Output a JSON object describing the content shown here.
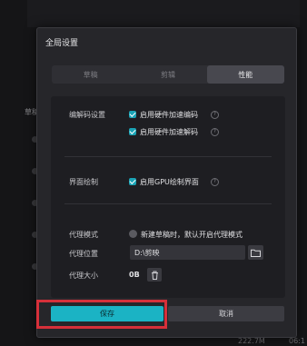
{
  "dialog": {
    "title": "全局设置",
    "tabs": [
      {
        "label": "草稿",
        "active": false
      },
      {
        "label": "剪辑",
        "active": false
      },
      {
        "label": "性能",
        "active": true
      }
    ]
  },
  "codec": {
    "label": "编解码设置",
    "options": [
      {
        "label": "启用硬件加速编码",
        "checked": true
      },
      {
        "label": "启用硬件加速解码",
        "checked": true
      }
    ]
  },
  "render": {
    "label": "界面绘制",
    "option": {
      "label": "启用GPU绘制界面",
      "checked": true
    }
  },
  "proxy": {
    "mode_label": "代理模式",
    "mode_option": "新建草稿时，默认开启代理模式",
    "mode_enabled": false,
    "location_label": "代理位置",
    "location_value": "D:\\剪映",
    "size_label": "代理大小",
    "size_value": "0B"
  },
  "buttons": {
    "save": "保存",
    "cancel": "取消"
  },
  "background": {
    "left_label": "草稿",
    "bottom_size": "222.7M",
    "bottom_right": "06:1"
  },
  "colors": {
    "accent": "#1bb3c4",
    "highlight_box": "#d6303a"
  }
}
